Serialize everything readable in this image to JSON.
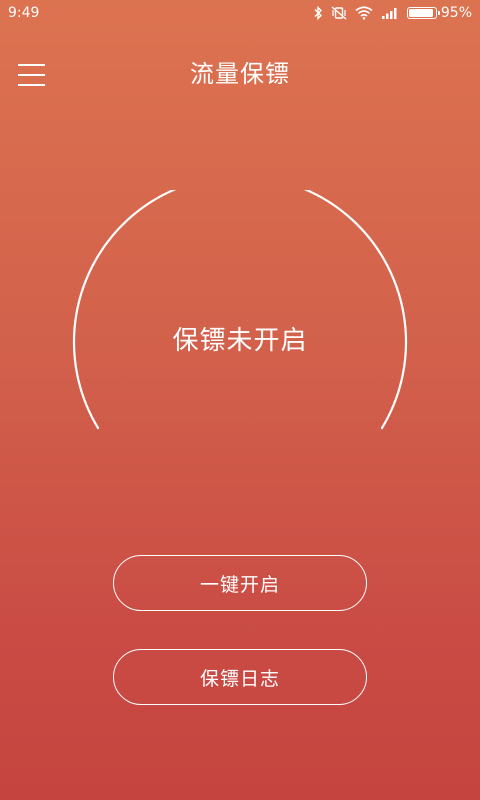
{
  "status_bar": {
    "time": "9:49",
    "battery_percent": "95%",
    "battery_level": 0.95,
    "icons": [
      "bluetooth-icon",
      "vibrate-off-icon",
      "wifi-icon",
      "signal-icon",
      "battery-icon"
    ]
  },
  "app_bar": {
    "title": "流量保镖",
    "menu_icon": "hamburger-menu-icon"
  },
  "gauge": {
    "status_label": "保镖未开启"
  },
  "buttons": {
    "start_label": "一键开启",
    "log_label": "保镖日志"
  },
  "colors": {
    "background_top": "#dc7350",
    "background_bottom": "#c5443f",
    "foreground": "#ffffff"
  }
}
